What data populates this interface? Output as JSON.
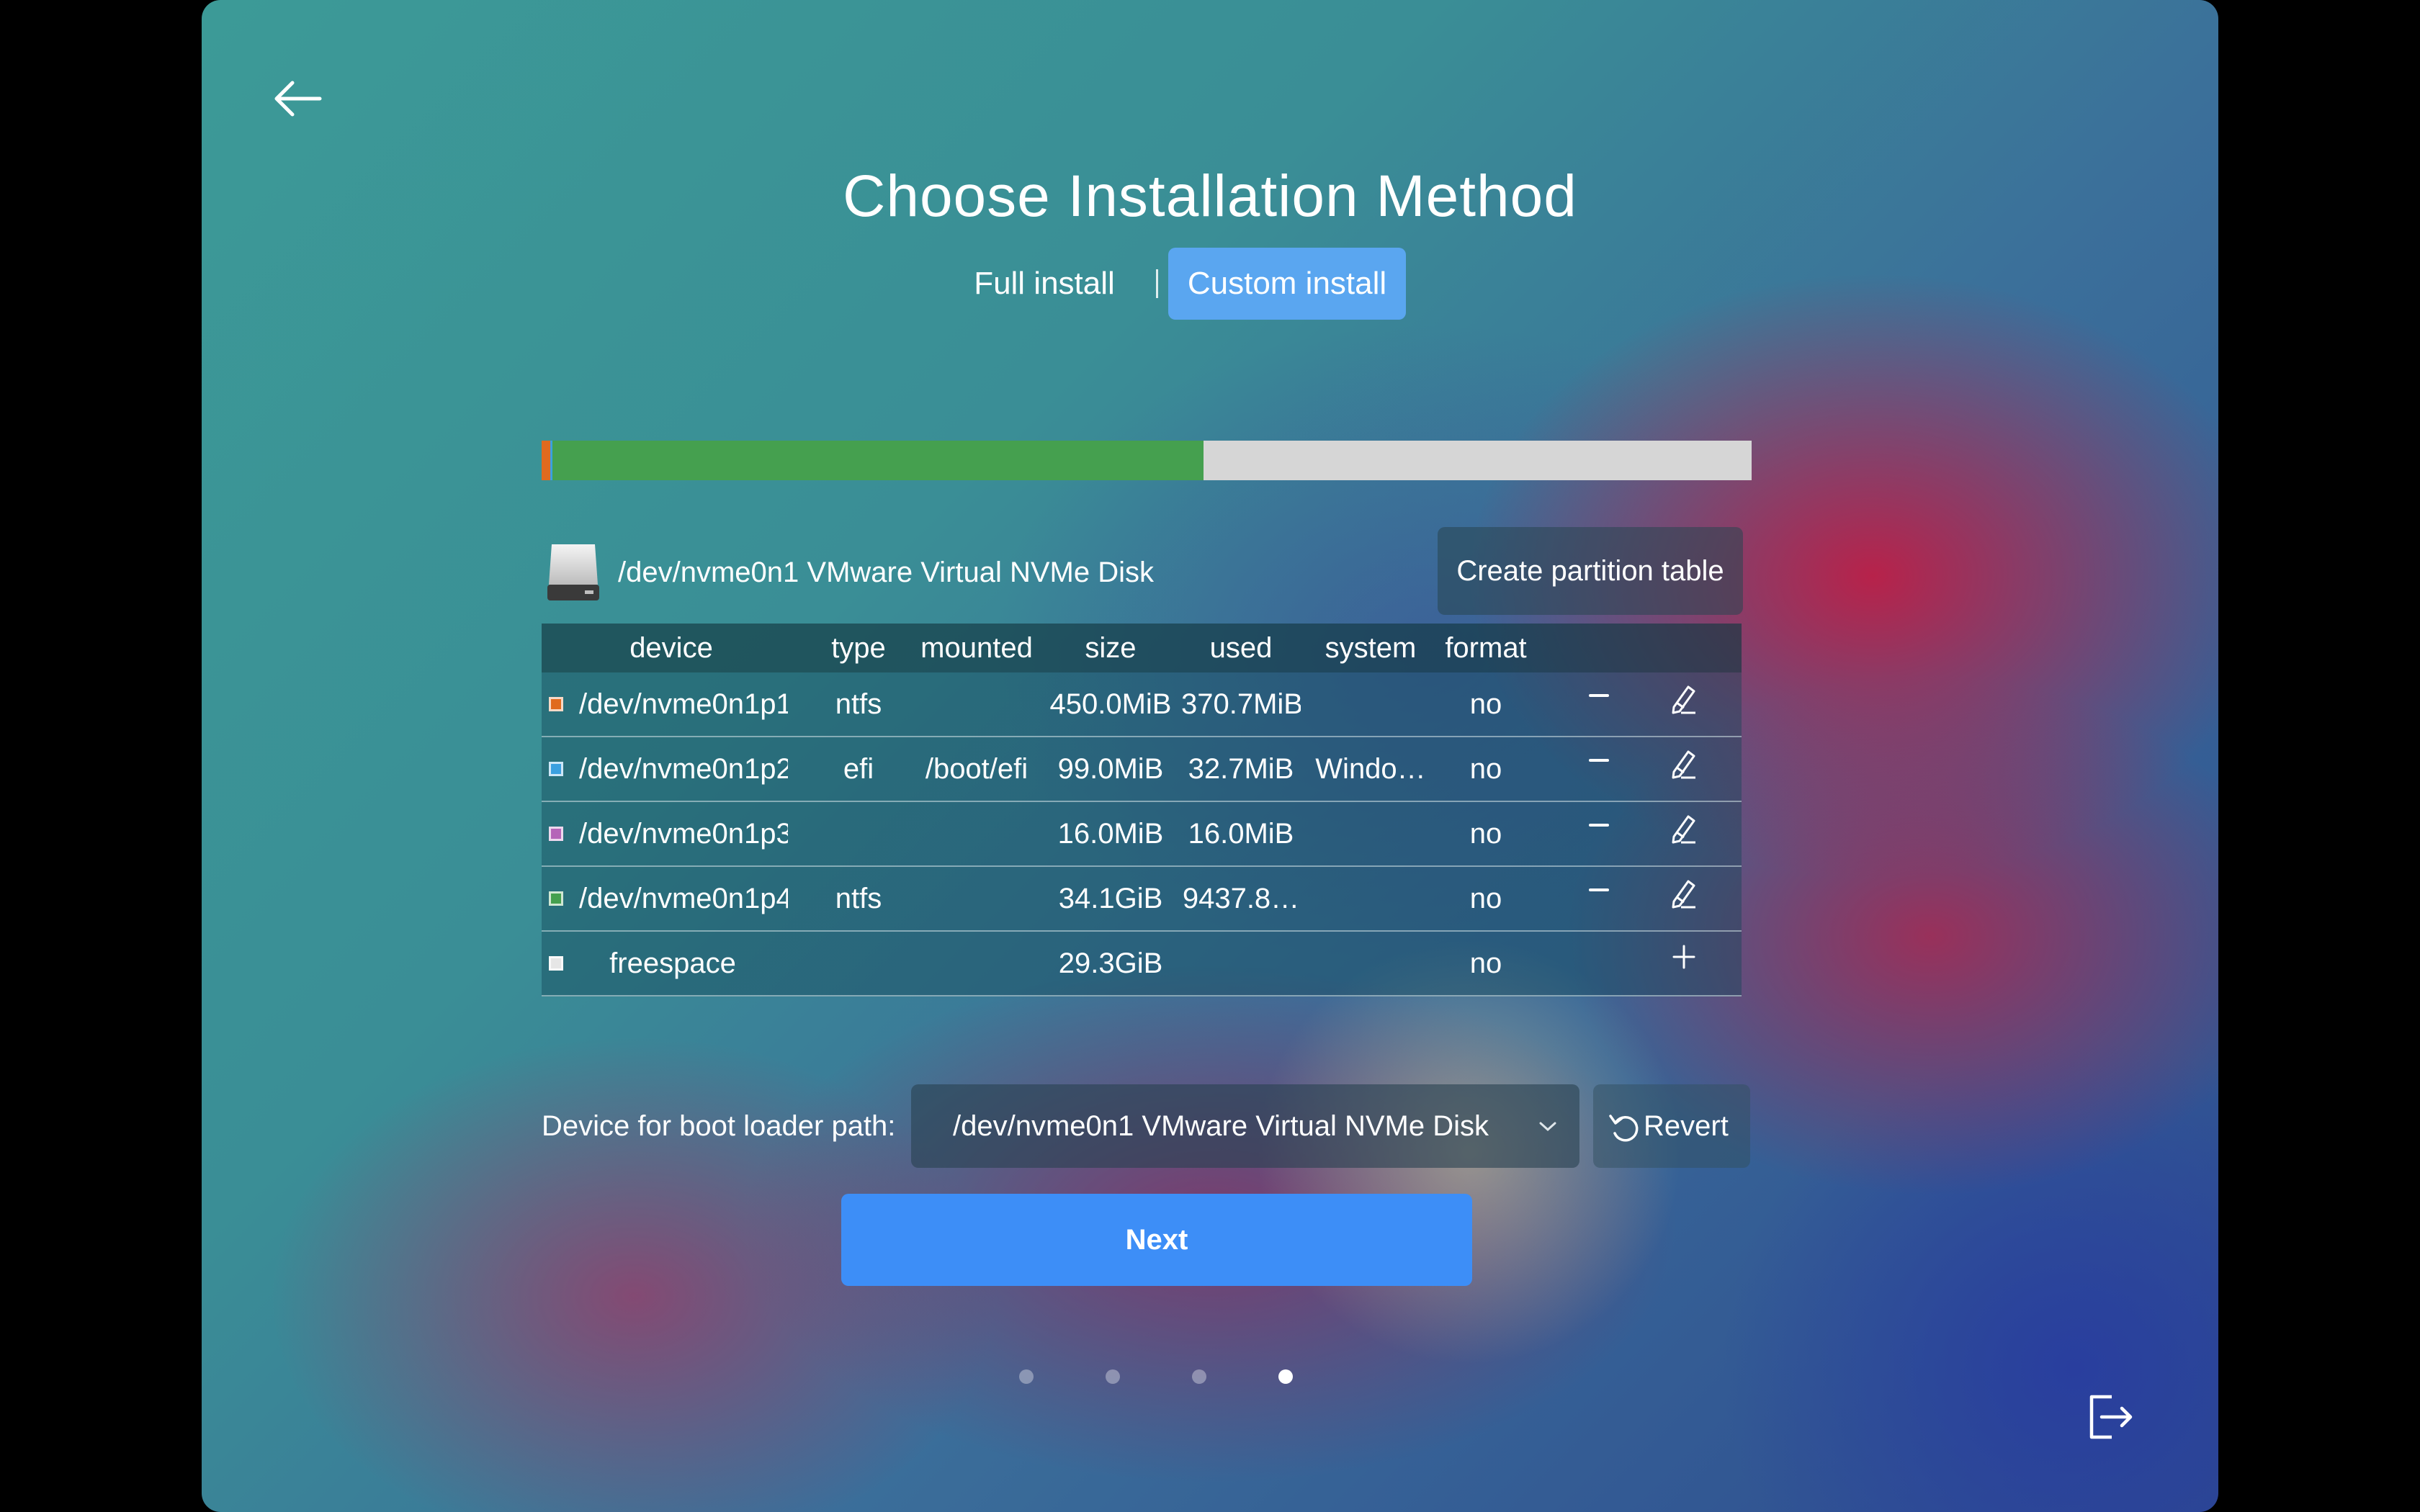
{
  "header": {
    "title": "Choose Installation Method",
    "tabs": [
      {
        "label": "Full install",
        "selected": false
      },
      {
        "label": "Custom install",
        "selected": true
      }
    ]
  },
  "usage_bar": {
    "segments": [
      {
        "name": "/dev/nvme0n1p1",
        "fraction": 0.007,
        "color": "#e06a1e"
      },
      {
        "name": "/dev/nvme0n1p2",
        "fraction": 0.001,
        "color": "#3ba0e0"
      },
      {
        "name": "/dev/nvme0n1p4",
        "fraction": 0.538,
        "color": "#45a04f"
      },
      {
        "name": "freespace",
        "fraction": 0.454,
        "color": "#d6d6d6"
      }
    ]
  },
  "disk": {
    "label": "/dev/nvme0n1 VMware Virtual NVMe Disk",
    "icon": "hard-disk-icon",
    "create_table_label": "Create partition table"
  },
  "table": {
    "columns": [
      "device",
      "type",
      "mounted",
      "size",
      "used",
      "system",
      "format"
    ],
    "rows": [
      {
        "color": "#e06a1e",
        "device": "/dev/nvme0n1p1",
        "type": "ntfs",
        "mounted": "",
        "size": "450.0MiB",
        "used": "370.7MiB",
        "system": "",
        "format": "no",
        "actions": [
          "remove",
          "edit"
        ]
      },
      {
        "color": "#3ba0e0",
        "device": "/dev/nvme0n1p2",
        "type": "efi",
        "mounted": "/boot/efi",
        "size": "99.0MiB",
        "used": "32.7MiB",
        "system": "Windo…",
        "format": "no",
        "actions": [
          "remove",
          "edit"
        ]
      },
      {
        "color": "#b565b8",
        "device": "/dev/nvme0n1p3",
        "type": "",
        "mounted": "",
        "size": "16.0MiB",
        "used": "16.0MiB",
        "system": "",
        "format": "no",
        "actions": [
          "remove",
          "edit"
        ]
      },
      {
        "color": "#45a04f",
        "device": "/dev/nvme0n1p4",
        "type": "ntfs",
        "mounted": "",
        "size": "34.1GiB",
        "used": "9437.8…",
        "system": "",
        "format": "no",
        "actions": [
          "remove",
          "edit"
        ]
      },
      {
        "color": "#e6e6e6",
        "device": "freespace",
        "type": "",
        "mounted": "",
        "size": "29.3GiB",
        "used": "",
        "system": "",
        "format": "no",
        "actions": [
          "add"
        ]
      }
    ]
  },
  "bootloader": {
    "label": "Device for boot loader path:",
    "selected": "/dev/nvme0n1 VMware Virtual NVMe Disk",
    "revert_label": "Revert"
  },
  "next_label": "Next",
  "pagination": {
    "total": 4,
    "current": 4
  }
}
